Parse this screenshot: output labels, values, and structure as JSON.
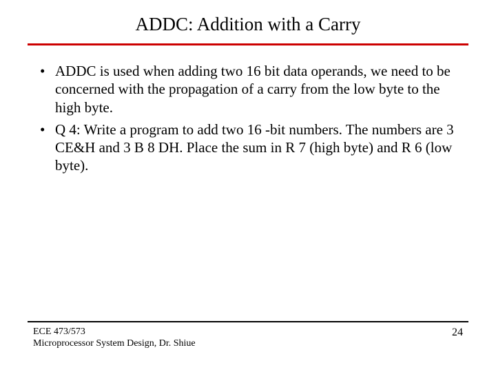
{
  "title": "ADDC: Addition with a Carry",
  "bullets": [
    "ADDC is used when adding two 16 bit data operands, we need to be concerned with the propagation of a carry from the low byte to the high byte.",
    "Q 4: Write a program to add two 16 -bit numbers. The numbers are 3 CE&H and 3 B 8 DH. Place the sum in R 7 (high byte) and R 6 (low byte)."
  ],
  "footer": {
    "course": "ECE 473/573",
    "subtitle": "Microprocessor System Design, Dr. Shiue",
    "page": "24"
  }
}
